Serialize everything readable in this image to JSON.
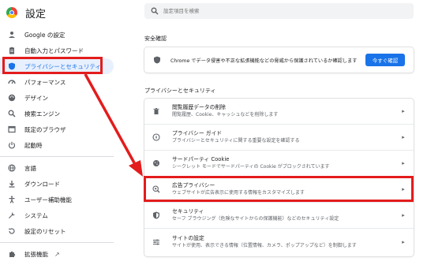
{
  "app": {
    "title": "設定"
  },
  "sidebar": {
    "items": [
      {
        "label": "Google の設定",
        "icon": "person-icon"
      },
      {
        "label": "自動入力とパスワード",
        "icon": "clipboard-icon"
      },
      {
        "label": "プライバシーとセキュリティ",
        "icon": "shield-icon",
        "active": true
      },
      {
        "label": "パフォーマンス",
        "icon": "speedometer-icon"
      },
      {
        "label": "デザイン",
        "icon": "palette-icon"
      },
      {
        "label": "検索エンジン",
        "icon": "search-icon"
      },
      {
        "label": "既定のブラウザ",
        "icon": "browser-icon"
      },
      {
        "label": "起動時",
        "icon": "power-icon"
      },
      {
        "label": "言語",
        "icon": "globe-icon"
      },
      {
        "label": "ダウンロード",
        "icon": "download-icon"
      },
      {
        "label": "ユーザー補助機能",
        "icon": "accessibility-icon"
      },
      {
        "label": "システム",
        "icon": "wrench-icon"
      },
      {
        "label": "設定のリセット",
        "icon": "reset-icon"
      },
      {
        "label": "拡張機能",
        "icon": "puzzle-icon"
      }
    ]
  },
  "search": {
    "placeholder": "設定項目を検索"
  },
  "safety_check": {
    "heading": "安全確認",
    "text": "Chrome でデータ侵害や不正な拡張機能などの脅威から保護されているか確認します",
    "button": "今すぐ確認"
  },
  "privacy": {
    "heading": "プライバシーとセキュリティ",
    "rows": [
      {
        "title": "閲覧履歴データの削除",
        "subtitle": "閲覧履歴、Cookie、キャッシュなどを削除します",
        "icon": "trash-icon"
      },
      {
        "title": "プライバシー ガイド",
        "subtitle": "プライバシーとセキュリティに関する重要な設定を確認する",
        "icon": "privacy-guide-icon"
      },
      {
        "title": "サードパーティ Cookie",
        "subtitle": "シークレット モードでサードパーティの Cookie がブロックされています",
        "icon": "cookie-icon"
      },
      {
        "title": "広告プライバシー",
        "subtitle": "ウェブサイトが広告表示に使用する情報をカスタマイズします",
        "icon": "ad-privacy-icon"
      },
      {
        "title": "セキュリティ",
        "subtitle": "セーフ ブラウジング（危険なサイトからの保護機能）などのセキュリティ設定",
        "icon": "security-icon"
      },
      {
        "title": "サイトの設定",
        "subtitle": "サイトが使用、表示できる情報（位置情報、カメラ、ポップアップなど）を制御します",
        "icon": "sliders-icon"
      }
    ]
  },
  "colors": {
    "accent": "#1a73e8",
    "highlight": "#e31c1c",
    "active_bg": "#e8f0fe"
  }
}
